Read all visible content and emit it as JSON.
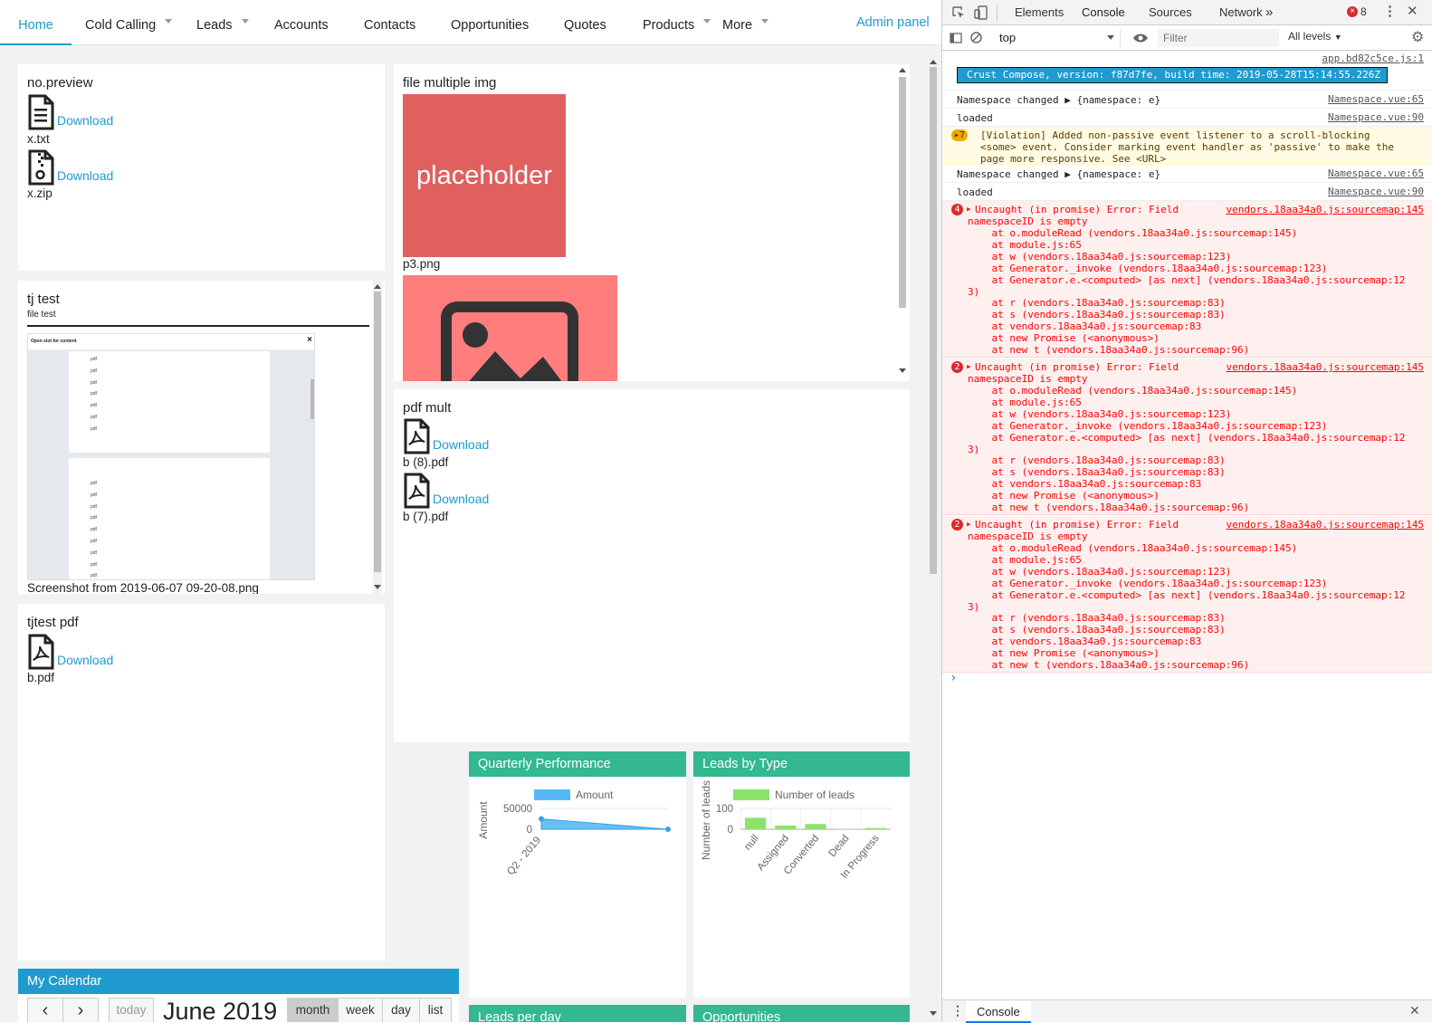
{
  "nav": {
    "items": [
      {
        "label": "Home",
        "caret": false,
        "active": true
      },
      {
        "label": "Cold Calling",
        "caret": true
      },
      {
        "label": "Leads",
        "caret": true
      },
      {
        "label": "Accounts",
        "caret": false
      },
      {
        "label": "Contacts",
        "caret": false
      },
      {
        "label": "Opportunities",
        "caret": false
      },
      {
        "label": "Quotes",
        "caret": false
      },
      {
        "label": "Products",
        "caret": true
      },
      {
        "label": "More",
        "caret": true
      }
    ],
    "admin": "Admin panel"
  },
  "panels": {
    "nopreview": {
      "title": "no.preview",
      "files": [
        {
          "download": "Download",
          "name": "x.txt",
          "icon": "text-file-icon"
        },
        {
          "download": "Download",
          "name": "x.zip",
          "icon": "zip-file-icon"
        }
      ]
    },
    "tjtest": {
      "title": "tj test",
      "subtitle": "file test",
      "modal_title": "Open slot for content",
      "pdf_word": "pdf",
      "caption": "Screenshot from 2019-06-07 09-20-08.png"
    },
    "tjtestpdf": {
      "title": "tjtest pdf",
      "files": [
        {
          "download": "Download",
          "name": "b.pdf",
          "icon": "pdf-file-icon"
        }
      ]
    },
    "filemulti": {
      "title": "file multiple img",
      "img1_text": "placeholder",
      "img1_name": "p3.png",
      "img1_color": "#e06060",
      "img2_color": "#ff7d7d"
    },
    "pdfmult": {
      "title": "pdf mult",
      "files": [
        {
          "download": "Download",
          "name": "b (8).pdf",
          "icon": "pdf-file-icon"
        },
        {
          "download": "Download",
          "name": "b (7).pdf",
          "icon": "pdf-file-icon"
        }
      ]
    },
    "quarterly": {
      "title": "Quarterly Performance"
    },
    "leadsbytype": {
      "title": "Leads by Type"
    },
    "leadsperday": {
      "title": "Leads per day"
    },
    "opportunities": {
      "title": "Opportunities"
    },
    "calendar": {
      "title": "My Calendar",
      "prev": "‹",
      "next": "›",
      "today": "today",
      "heading": "June 2019",
      "views": [
        "month",
        "week",
        "day",
        "list"
      ],
      "active_view": "month"
    }
  },
  "chart_data": [
    {
      "type": "area",
      "legend": [
        "Amount"
      ],
      "ylabel": "Amount",
      "categories": [
        "Q2 - 2019"
      ],
      "yticks": [
        50000,
        0
      ],
      "series": [
        {
          "name": "Amount",
          "values": [
            25000,
            0
          ]
        }
      ],
      "color": "#56b8f5"
    },
    {
      "type": "bar",
      "legend": [
        "Number of leads"
      ],
      "ylabel": "Number of leads",
      "categories": [
        "null",
        "Assigned",
        "Converted",
        "Dead",
        "In Progress"
      ],
      "yticks": [
        100,
        0
      ],
      "series": [
        {
          "name": "Number of leads",
          "values": [
            55,
            18,
            25,
            1,
            6
          ]
        }
      ],
      "ylim": [
        0,
        100
      ],
      "color": "#8de26c"
    }
  ],
  "devtools": {
    "tabs": [
      "Elements",
      "Console",
      "Sources",
      "Network"
    ],
    "active_tab": "Console",
    "more_tabs": "»",
    "error_count": "8",
    "context": "top",
    "filter_placeholder": "Filter",
    "levels": "All levels",
    "first_src": "app.bd82c5ce.js:1",
    "banner": "Crust Compose, version: f87d7fe, build time: 2019-05-28T15:14:55.226Z",
    "logs": [
      {
        "text": "Namespace changed ▶ {namespace: e}",
        "src": "Namespace.vue:65"
      },
      {
        "text": "loaded",
        "src": "Namespace.vue:90"
      },
      {
        "text": "Namespace changed ▶ {namespace: e}",
        "src": "Namespace.vue:65"
      },
      {
        "text": "loaded",
        "src": "Namespace.vue:90"
      }
    ],
    "warning": {
      "count": "7",
      "lines": [
        "[Violation] Added non-passive event listener to a scroll-blocking",
        "<some> event. Consider marking event handler as 'passive' to make the",
        "page more responsive. See <URL>"
      ]
    },
    "errors": [
      {
        "count": "4"
      },
      {
        "count": "2"
      },
      {
        "count": "2"
      }
    ],
    "error_head": [
      "Uncaught (in promise) Error: Field",
      "namespaceID is empty"
    ],
    "error_src": "vendors.18aa34a0.js:sourcemap:145",
    "trace": [
      "    at o.moduleRead (vendors.18aa34a0.js:sourcemap:145)",
      "    at module.js:65",
      "    at w (vendors.18aa34a0.js:sourcemap:123)",
      "    at Generator._invoke (vendors.18aa34a0.js:sourcemap:123)",
      "    at Generator.e.<computed> [as next] (vendors.18aa34a0.js:sourcemap:12",
      "3)",
      "    at r (vendors.18aa34a0.js:sourcemap:83)",
      "    at s (vendors.18aa34a0.js:sourcemap:83)",
      "    at vendors.18aa34a0.js:sourcemap:83",
      "    at new Promise (<anonymous>)",
      "    at new t (vendors.18aa34a0.js:sourcemap:96)"
    ],
    "prompt": "›",
    "drawer_tab": "Console"
  }
}
